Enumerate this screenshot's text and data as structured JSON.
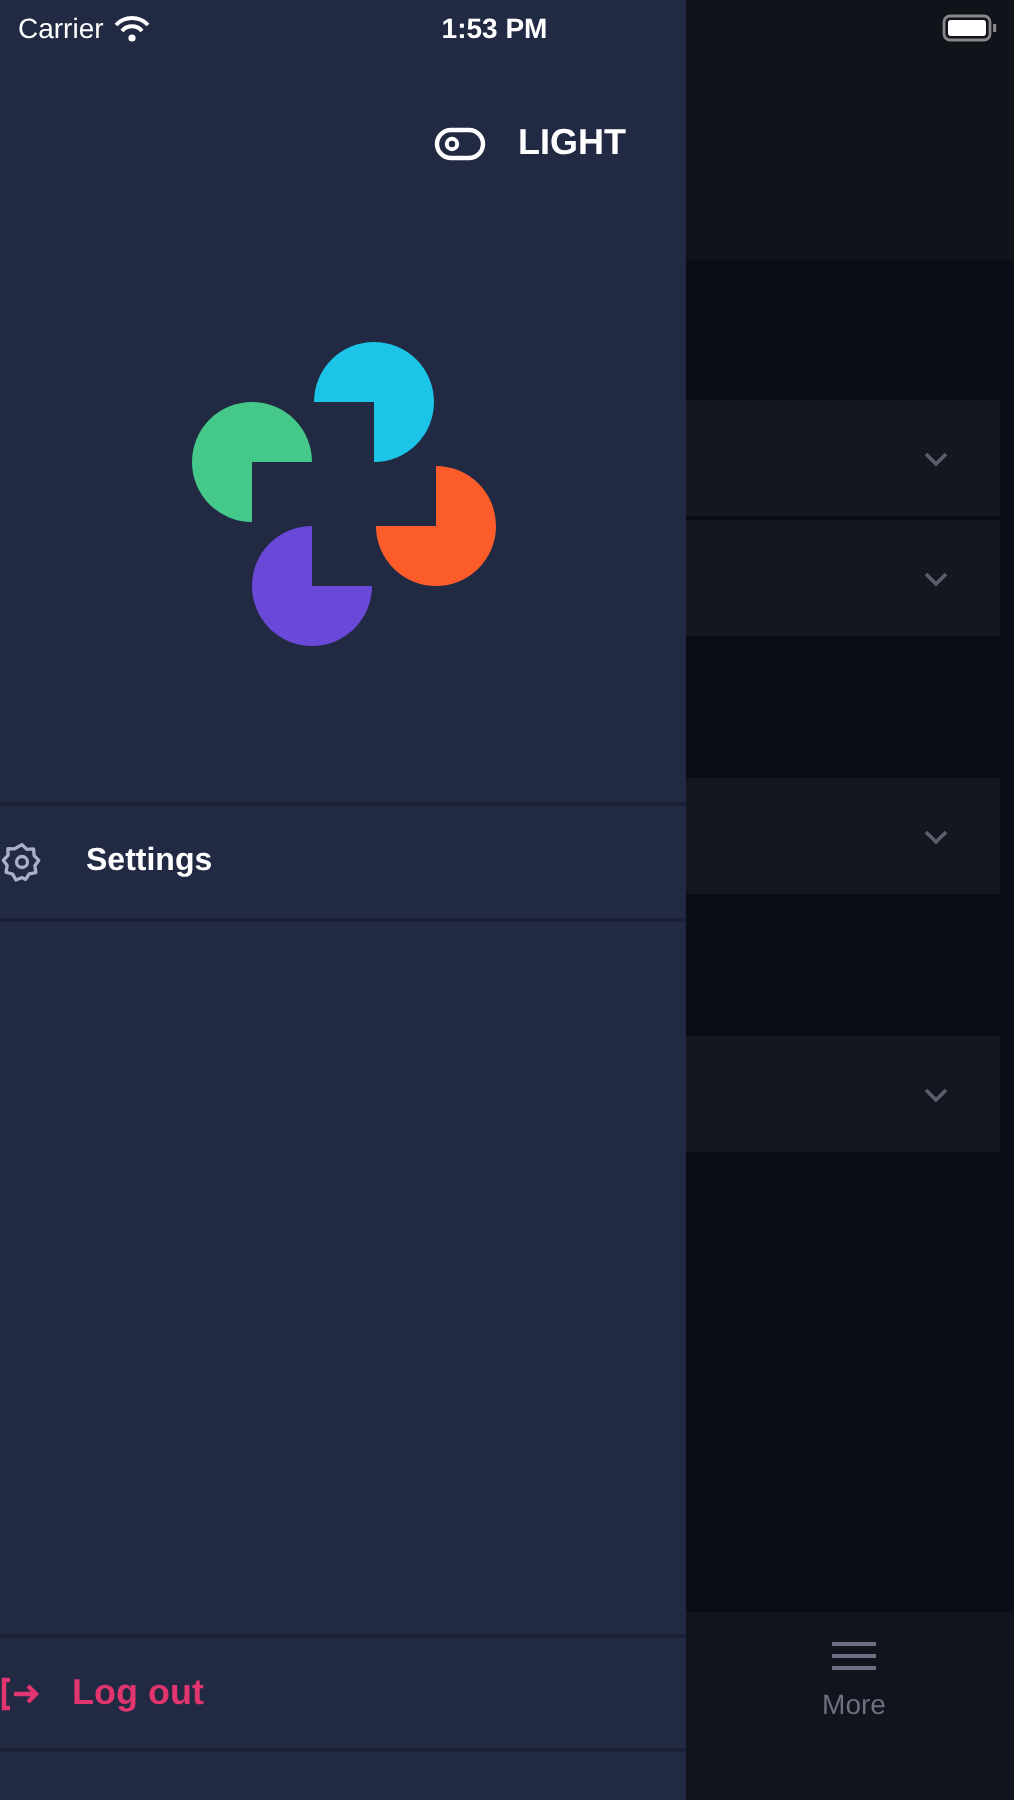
{
  "status_bar": {
    "carrier": "Carrier",
    "time": "1:53 PM"
  },
  "drawer": {
    "theme_toggle": {
      "label": "LIGHT",
      "on": false
    },
    "menu_items": [
      {
        "label": "Settings",
        "kind": "settings"
      }
    ],
    "logout": {
      "label": "Log out"
    }
  },
  "background_screen": {
    "sections": [
      {
        "cards": [
          {
            "expanded": false
          },
          {
            "expanded": false
          }
        ]
      },
      {
        "cards": [
          {
            "expanded": false
          }
        ]
      },
      {
        "cards": [
          {
            "expanded": false
          }
        ]
      }
    ],
    "tab_bar": {
      "items": [
        {
          "label": "More",
          "selected": false
        }
      ]
    }
  }
}
